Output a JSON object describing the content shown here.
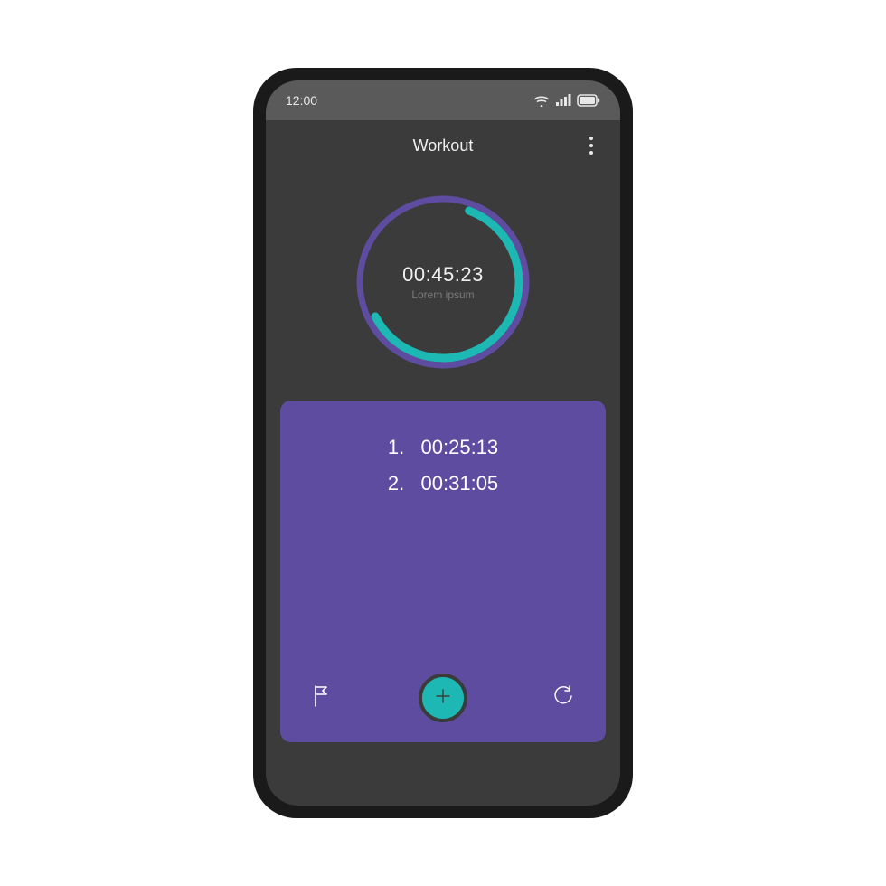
{
  "status": {
    "time": "12:00"
  },
  "header": {
    "title": "Workout"
  },
  "timer": {
    "elapsed": "00:45:23",
    "subtitle": "Lorem ipsum",
    "colors": {
      "ring_outer": "#5d4ca0",
      "ring_progress": "#1eb8b4"
    },
    "progress_percent": 62
  },
  "laps": {
    "panel_color": "#5d4ca0",
    "items": [
      {
        "index": "1.",
        "time": "00:25:13"
      },
      {
        "index": "2.",
        "time": "00:31:05"
      }
    ]
  },
  "actions": {
    "flag": "flag",
    "add": "+",
    "reset": "reset"
  }
}
